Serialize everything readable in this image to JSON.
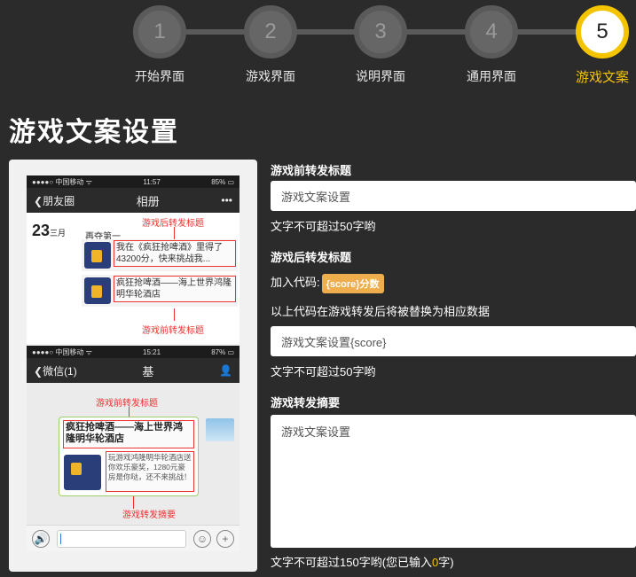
{
  "stepper": {
    "steps": [
      {
        "number": "1",
        "label": "开始界面"
      },
      {
        "number": "2",
        "label": "游戏界面"
      },
      {
        "number": "3",
        "label": "说明界面"
      },
      {
        "number": "4",
        "label": "通用界面"
      },
      {
        "number": "5",
        "label": "游戏文案"
      }
    ],
    "active_step": 5,
    "active_color": "#f5c400"
  },
  "page_title": "游戏文案设置",
  "preview": {
    "moments": {
      "status_left": "●●●●○ 中国移动 ᯤ",
      "status_time": "11:57",
      "status_right": "85% ▭",
      "back_label": "朋友圈",
      "nav_title": "相册",
      "more": "•••",
      "date_day": "23",
      "date_month": "三月",
      "user_name": "再夺第一",
      "anno_after_title": "游戏后转发标题",
      "post_after_text": "我在《疯狂抢啤酒》里得了43200分，快来挑战我...",
      "post_before_text": "疯狂抢啤酒——海上世界鸿隆明华轮酒店",
      "anno_before_title": "游戏前转发标题"
    },
    "chat": {
      "status_left": "●●●●○ 中国移动 ᯤ",
      "status_time": "15:21",
      "status_right": "87% ▭",
      "back_label": "微信(1)",
      "nav_title": "基",
      "anno_before_title": "游戏前转发标题",
      "card_title": "疯狂抢啤酒——海上世界鸿隆明华轮酒店",
      "card_summary": "玩游戏鸿隆明华轮酒店送你欢乐豪奖，1280元豪房是你哒，还不来挑战！",
      "anno_summary": "游戏转发摘要"
    }
  },
  "form": {
    "pre_share_title_label": "游戏前转发标题",
    "pre_share_title_value": "游戏文案设置",
    "pre_share_title_hint": "文字不可超过50字哟",
    "post_share_title_label": "游戏后转发标题",
    "code_prefix": "加入代码:",
    "code_tag": "{score}分数",
    "code_explain": "以上代码在游戏转发后将被替换为相应数据",
    "post_share_title_value": "游戏文案设置{score}",
    "post_share_title_hint": "文字不可超过50字哟",
    "summary_label": "游戏转发摘要",
    "summary_value": "游戏文案设置",
    "summary_hint_prefix": "文字不可超过150字哟(您已输入",
    "summary_count": "0",
    "summary_hint_suffix": "字)"
  }
}
